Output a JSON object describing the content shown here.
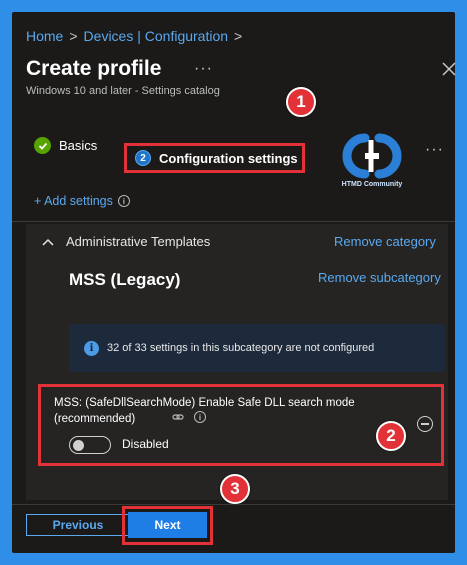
{
  "breadcrumb": {
    "home": "Home",
    "current": "Devices | Configuration"
  },
  "header": {
    "title": "Create profile",
    "more": "···",
    "subtitle": "Windows 10 and later - Settings catalog"
  },
  "tabs": [
    {
      "label": "Basics",
      "state": "complete"
    },
    {
      "number": "2",
      "label": "Configuration settings",
      "state": "active"
    }
  ],
  "tabs_more": "···",
  "logo": {
    "caption": "HTMD Community"
  },
  "add_settings": "+ Add settings",
  "category": {
    "name": "Administrative Templates",
    "remove_label": "Remove category"
  },
  "subcategory": {
    "name": "MSS (Legacy)",
    "remove_label": "Remove subcategory"
  },
  "info_banner": "32 of 33 settings in this subcategory are not configured",
  "setting": {
    "name": "MSS: (SafeDllSearchMode) Enable Safe DLL search mode (recommended)",
    "toggle_label": "Disabled",
    "toggle_on": false
  },
  "steps": [
    "1",
    "2",
    "3"
  ],
  "footer": {
    "previous": "Previous",
    "next": "Next"
  },
  "colors": {
    "background": "#2f8fe8",
    "panel": "#1b1a19",
    "accent": "#5aa9f0",
    "highlight": "#e23238",
    "primary_button": "#1f7ee6"
  }
}
